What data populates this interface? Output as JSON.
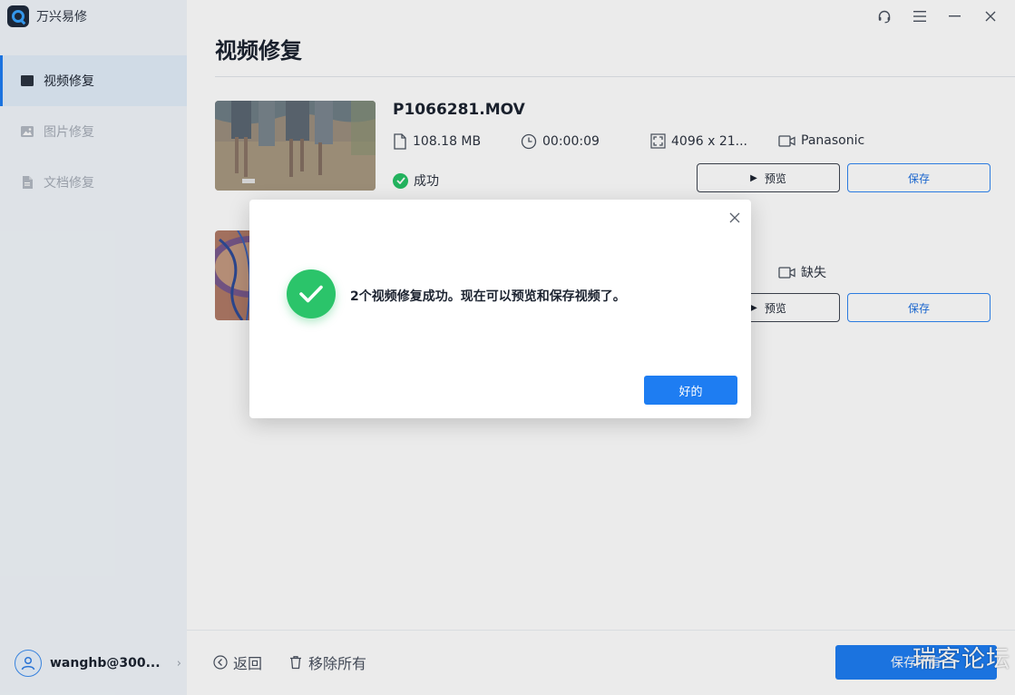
{
  "app": {
    "title": "万兴易修",
    "brand_color": "#1e7df2"
  },
  "sidebar": {
    "items": [
      {
        "label": "视频修复",
        "icon": "video-icon",
        "active": true
      },
      {
        "label": "图片修复",
        "icon": "image-icon",
        "active": false
      },
      {
        "label": "文档修复",
        "icon": "document-icon",
        "active": false
      }
    ],
    "user": {
      "name": "wanghb@300...",
      "icon": "user-avatar-icon"
    }
  },
  "window_controls": [
    "headset-icon",
    "menu-icon",
    "minimize-icon",
    "close-icon"
  ],
  "main": {
    "title": "视频修复",
    "files": [
      {
        "name": "P1066281.MOV",
        "size": "108.18  MB",
        "duration": "00:00:09",
        "resolution": "4096 x 21...",
        "camera": "Panasonic",
        "status": "成功",
        "preview_label": "预览",
        "save_label": "保存"
      },
      {
        "name": "",
        "camera": "缺失",
        "preview_label": "预览",
        "save_label": "保存"
      }
    ]
  },
  "footer": {
    "back_label": "返回",
    "remove_all_label": "移除所有",
    "save_all_label": "保存所有",
    "watermark": "瑞客论坛"
  },
  "dialog": {
    "message": "2个视频修复成功。现在可以预览和保存视频了。",
    "ok_label": "好的",
    "success_color": "#2bc46a"
  }
}
